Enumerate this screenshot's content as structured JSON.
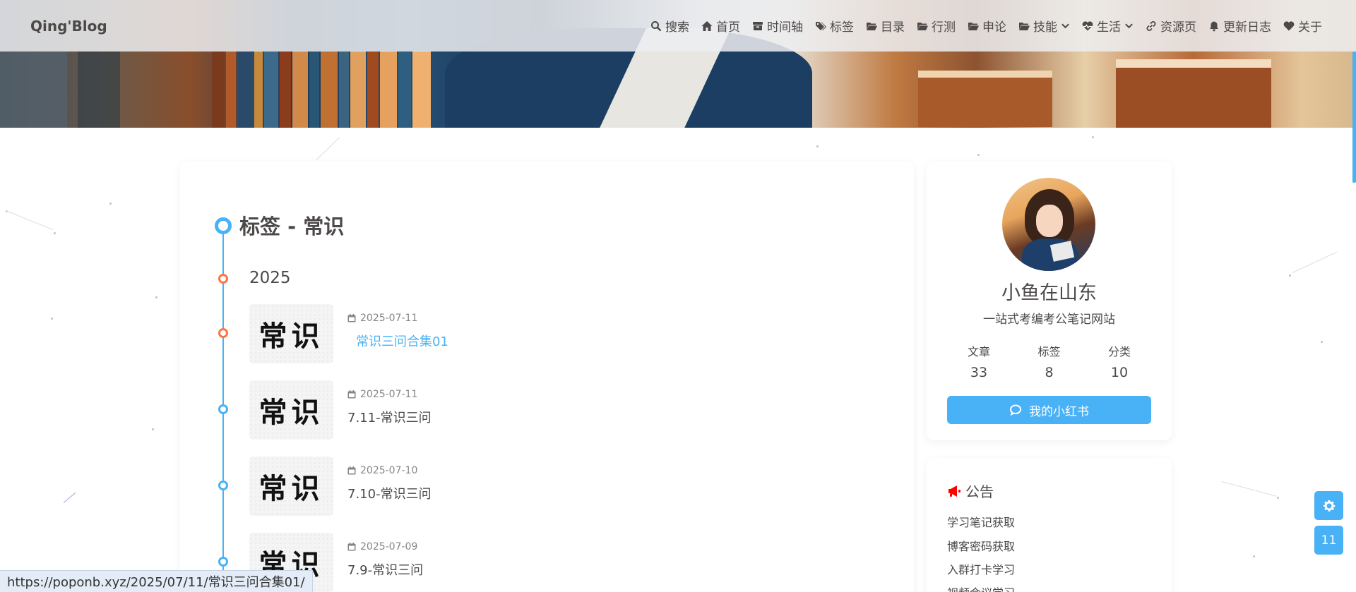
{
  "brand": "Qing'Blog",
  "nav": [
    {
      "label": "搜索",
      "icon": "search-icon"
    },
    {
      "label": "首页",
      "icon": "home-icon"
    },
    {
      "label": "时间轴",
      "icon": "archive-icon"
    },
    {
      "label": "标签",
      "icon": "tags-icon"
    },
    {
      "label": "目录",
      "icon": "folder-open-icon"
    },
    {
      "label": "行测",
      "icon": "folder-open-icon"
    },
    {
      "label": "申论",
      "icon": "folder-open-icon"
    },
    {
      "label": "技能",
      "icon": "folder-open-icon",
      "dropdown": true
    },
    {
      "label": "生活",
      "icon": "heart-pulse-icon",
      "dropdown": true
    },
    {
      "label": "资源页",
      "icon": "link-icon"
    },
    {
      "label": "更新日志",
      "icon": "bell-icon"
    },
    {
      "label": "关于",
      "icon": "heart-icon"
    }
  ],
  "page": {
    "title": "标签 - 常识",
    "year": "2025"
  },
  "posts": [
    {
      "date": "2025-07-11",
      "title": "常识三问合集01",
      "thumb_text": "常识",
      "active": true
    },
    {
      "date": "2025-07-11",
      "title": "7.11-常识三问",
      "thumb_text": "常识",
      "active": false
    },
    {
      "date": "2025-07-10",
      "title": "7.10-常识三问",
      "thumb_text": "常识",
      "active": false
    },
    {
      "date": "2025-07-09",
      "title": "7.9-常识三问",
      "thumb_text": "常识",
      "active": false
    }
  ],
  "author": {
    "name": "小鱼在山东",
    "description": "一站式考编考公笔记网站",
    "stats": [
      {
        "label": "文章",
        "value": "33"
      },
      {
        "label": "标签",
        "value": "8"
      },
      {
        "label": "分类",
        "value": "10"
      }
    ],
    "button_label": "我的小红书"
  },
  "notice": {
    "title": "公告",
    "links": [
      "学习笔记获取",
      "博客密码获取",
      "入群打卡学习",
      "视频会议学习"
    ]
  },
  "float_buttons": {
    "settings_icon": "gear-icon",
    "counter": "11"
  },
  "status_url": "https://poponb.xyz/2025/07/11/常识三问合集01/",
  "colors": {
    "accent": "#49b1f5",
    "timeline_orange": "#ff7242",
    "notice_icon": "#ff0000"
  }
}
